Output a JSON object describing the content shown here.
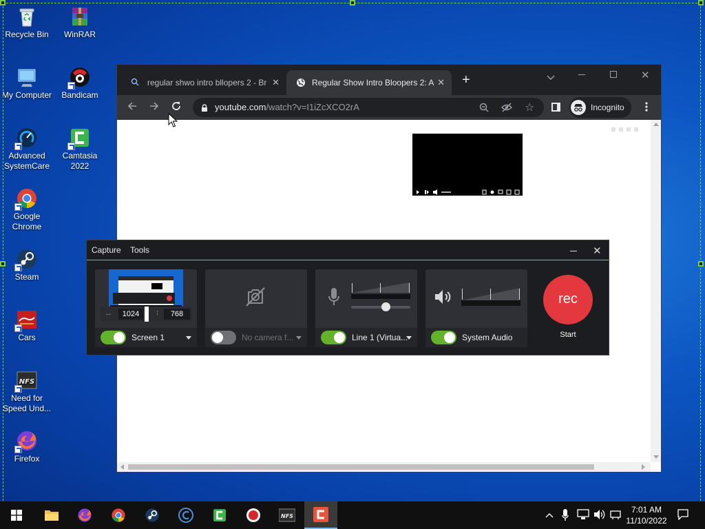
{
  "desktop": {
    "icons": [
      {
        "label": "Recycle Bin",
        "icon": "recycle-bin-icon"
      },
      {
        "label": "WinRAR",
        "icon": "winrar-icon"
      },
      {
        "label": "My Computer",
        "icon": "computer-icon"
      },
      {
        "label": "Bandicam",
        "icon": "bandicam-icon"
      },
      {
        "label": "Advanced SystemCare",
        "icon": "advanced-systemcare-icon"
      },
      {
        "label": "Camtasia 2022",
        "icon": "camtasia-icon"
      },
      {
        "label": "Google Chrome",
        "icon": "chrome-icon"
      },
      {
        "label": "Steam",
        "icon": "steam-icon"
      },
      {
        "label": "Cars",
        "icon": "cars-icon"
      },
      {
        "label": "Need for Speed Und...",
        "icon": "nfs-icon"
      },
      {
        "label": "Firefox",
        "icon": "firefox-icon"
      }
    ]
  },
  "browser": {
    "tabs": [
      {
        "title": "regular shwo intro bllopers 2 - Br",
        "icon": "search-icon",
        "active": false
      },
      {
        "title": "Regular Show Intro Bloopers 2: A",
        "icon": "globe-icon",
        "active": true
      }
    ],
    "url_host": "youtube.com",
    "url_path": "/watch?v=I1iZcXCO2rA",
    "profile_label": "Incognito"
  },
  "recorder": {
    "menu": [
      "Capture",
      "Tools"
    ],
    "screen": {
      "label": "Screen 1",
      "width": "1024",
      "height": "768",
      "enabled": true
    },
    "camera": {
      "label": "No camera f...",
      "enabled": false
    },
    "mic": {
      "label": "Line 1 (Virtua...",
      "enabled": true,
      "volume": 0.6
    },
    "audio": {
      "label": "System Audio",
      "enabled": true
    },
    "rec_label": "rec",
    "start_label": "Start"
  },
  "taskbar": {
    "apps": [
      "start-icon",
      "file-explorer-icon",
      "firefox-icon",
      "chrome-icon",
      "steam-icon",
      "ccleaner-icon",
      "camtasia-icon",
      "bandicam-icon",
      "nfs-icon",
      "camtasia-recorder-icon"
    ],
    "time": "7:01 AM",
    "date": "11/10/2022"
  },
  "colors": {
    "accent_green": "#74d23c",
    "rec_red": "#e3383d",
    "toggle_on": "#64b22b"
  }
}
